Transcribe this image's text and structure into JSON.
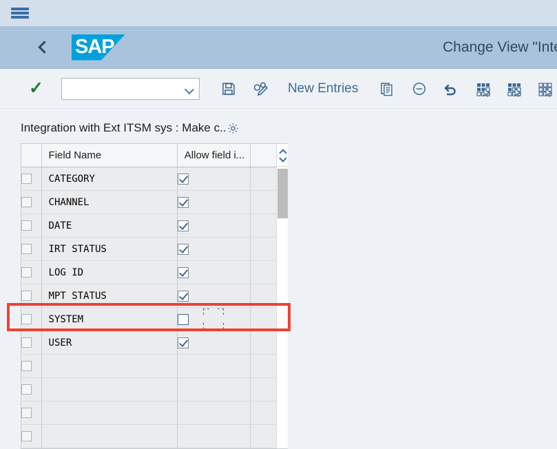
{
  "shell": {
    "menu_icon": "hamburger-menu-icon",
    "back_icon": "back-chevron-icon",
    "logo_text": "SAP",
    "title": "Change View \"Integ"
  },
  "toolbar": {
    "confirm_icon": "green-check-icon",
    "command_value": "",
    "command_placeholder": "",
    "dropdown_icon": "chevron-down-icon",
    "save_icon": "save-floppy-icon",
    "display_change_icon": "display-change-glasses-pencil-icon",
    "new_entries_label": "New Entries",
    "copy_icon": "copy-as-icon",
    "delete_icon": "delete-minus-circle-icon",
    "undo_icon": "undo-arrow-icon",
    "select_all_icon": "select-all-grid-icon",
    "select_block_icon": "select-block-grid-icon",
    "deselect_all_icon": "deselect-all-grid-icon"
  },
  "content": {
    "section_title": "Integration with Ext ITSM sys : Make c..",
    "settings_icon": "gear-settings-icon"
  },
  "table": {
    "columns": [
      {
        "key": "select",
        "label": ""
      },
      {
        "key": "field_name",
        "label": "Field Name"
      },
      {
        "key": "allow_field",
        "label": "Allow field i..."
      },
      {
        "key": "extra",
        "label": ""
      }
    ],
    "rows": [
      {
        "field_name": "CATEGORY",
        "allow_field": true,
        "row_selected": false,
        "highlighted": false,
        "focused": false
      },
      {
        "field_name": "CHANNEL",
        "allow_field": true,
        "row_selected": false,
        "highlighted": false,
        "focused": false
      },
      {
        "field_name": "DATE",
        "allow_field": true,
        "row_selected": false,
        "highlighted": false,
        "focused": false
      },
      {
        "field_name": "IRT STATUS",
        "allow_field": true,
        "row_selected": false,
        "highlighted": false,
        "focused": false
      },
      {
        "field_name": "LOG ID",
        "allow_field": true,
        "row_selected": false,
        "highlighted": false,
        "focused": false
      },
      {
        "field_name": "MPT STATUS",
        "allow_field": true,
        "row_selected": false,
        "highlighted": false,
        "focused": false
      },
      {
        "field_name": "SYSTEM",
        "allow_field": false,
        "row_selected": false,
        "highlighted": true,
        "focused": true
      },
      {
        "field_name": "USER",
        "allow_field": true,
        "row_selected": false,
        "highlighted": false,
        "focused": false
      },
      {
        "field_name": "",
        "allow_field": null,
        "row_selected": false,
        "highlighted": false,
        "focused": false
      },
      {
        "field_name": "",
        "allow_field": null,
        "row_selected": false,
        "highlighted": false,
        "focused": false
      },
      {
        "field_name": "",
        "allow_field": null,
        "row_selected": false,
        "highlighted": false,
        "focused": false
      },
      {
        "field_name": "",
        "allow_field": null,
        "row_selected": false,
        "highlighted": false,
        "focused": false
      }
    ],
    "scrollbar": {
      "up_icon": "scroll-up-icon",
      "down_icon": "scroll-down-icon"
    }
  },
  "annotation": {
    "color": "#ef4136",
    "target_row": "SYSTEM"
  }
}
